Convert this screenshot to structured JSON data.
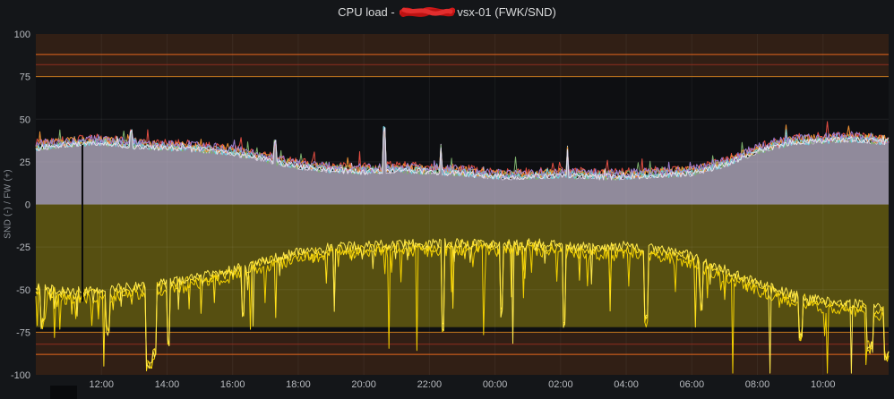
{
  "title": {
    "prefix": "CPU load - ",
    "suffix": "vsx-01 (FWK/SND)",
    "redacted_hint": "hostname scribbled out in red"
  },
  "chart_data": {
    "type": "line",
    "title": "CPU load - [redacted] vsx-01 (FWK/SND)",
    "ylabel": "SND (-) / FW (+)",
    "xlabel": "",
    "ylim": [
      -100,
      100
    ],
    "yticks": [
      100,
      75,
      50,
      25,
      0,
      -25,
      -50,
      -75,
      -100
    ],
    "ygrid": [
      75,
      50,
      25,
      0,
      -25,
      -50,
      -75
    ],
    "x_hours_span": 26,
    "xtick_hours": [
      2,
      4,
      6,
      8,
      10,
      12,
      14,
      16,
      18,
      20,
      22,
      24
    ],
    "xtick_labels": [
      "12:00",
      "14:00",
      "16:00",
      "18:00",
      "20:00",
      "22:00",
      "00:00",
      "02:00",
      "04:00",
      "06:00",
      "08:00",
      "10:00"
    ],
    "grid": true,
    "legend": "none",
    "samples": 640,
    "thresholds": {
      "bands": [
        {
          "from": 75,
          "to": 100,
          "color": "rgba(190,95,35,0.20)"
        },
        {
          "from": -100,
          "to": -75,
          "color": "rgba(190,95,35,0.20)"
        },
        {
          "from": -72,
          "to": 0,
          "color": "rgba(205,185,15,0.38)"
        }
      ],
      "lines": [
        {
          "v": 88,
          "color": "#e8671c"
        },
        {
          "v": 82,
          "color": "#8f2e1e"
        },
        {
          "v": 75,
          "color": "#c1761b"
        },
        {
          "v": -75,
          "color": "#c1761b"
        },
        {
          "v": -82,
          "color": "#8f2e1e"
        },
        {
          "v": -88,
          "color": "#e8671c"
        }
      ]
    },
    "envelopes": {
      "fw": [
        [
          0,
          33
        ],
        [
          1,
          35
        ],
        [
          2,
          36
        ],
        [
          3,
          34
        ],
        [
          4,
          33
        ],
        [
          5,
          32
        ],
        [
          6,
          30
        ],
        [
          7,
          26
        ],
        [
          8,
          22
        ],
        [
          9,
          20
        ],
        [
          10,
          19
        ],
        [
          11,
          20
        ],
        [
          12,
          19
        ],
        [
          13,
          18
        ],
        [
          14,
          16
        ],
        [
          15,
          16
        ],
        [
          16,
          17
        ],
        [
          17,
          16
        ],
        [
          18,
          16
        ],
        [
          19,
          17
        ],
        [
          20,
          18
        ],
        [
          21,
          23
        ],
        [
          22,
          31
        ],
        [
          23,
          36
        ],
        [
          24,
          37
        ],
        [
          25,
          38
        ],
        [
          26,
          36
        ]
      ],
      "snd": [
        [
          0,
          -50
        ],
        [
          1,
          -53
        ],
        [
          2,
          -52
        ],
        [
          3,
          -50
        ],
        [
          4,
          -48
        ],
        [
          5,
          -44
        ],
        [
          6,
          -40
        ],
        [
          7,
          -34
        ],
        [
          8,
          -30
        ],
        [
          9,
          -27
        ],
        [
          10,
          -26
        ],
        [
          11,
          -25
        ],
        [
          12,
          -25
        ],
        [
          13,
          -24
        ],
        [
          14,
          -25
        ],
        [
          15,
          -24
        ],
        [
          16,
          -26
        ],
        [
          17,
          -27
        ],
        [
          18,
          -26
        ],
        [
          19,
          -28
        ],
        [
          20,
          -32
        ],
        [
          21,
          -40
        ],
        [
          22,
          -48
        ],
        [
          23,
          -54
        ],
        [
          24,
          -58
        ],
        [
          25,
          -60
        ],
        [
          26,
          -63
        ]
      ]
    },
    "fw_area": {
      "seed": 100,
      "offset": 0,
      "amp": 1.6,
      "spike_p": 0.015,
      "spike_max": 5,
      "fill": "rgba(196,186,208,0.72)",
      "edge": "#cfc5da"
    },
    "fw_lines": [
      {
        "color": "#e24d42",
        "offset": 2.5,
        "amp": 3.0,
        "seed": 101,
        "spike_p": 0.025,
        "spike_max": 8
      },
      {
        "color": "#7eb26d",
        "offset": 1.0,
        "amp": 2.8,
        "seed": 102,
        "spike_p": 0.03,
        "spike_max": 9
      },
      {
        "color": "#ef9234",
        "offset": 1.8,
        "amp": 2.6,
        "seed": 103,
        "spike_p": 0.025,
        "spike_max": 7
      },
      {
        "color": "#6ed0e0",
        "offset": 0.6,
        "amp": 2.2,
        "seed": 104,
        "spike_p": 0.02,
        "spike_max": 6
      },
      {
        "color": "#9f7fd1",
        "offset": 2.2,
        "amp": 2.8,
        "seed": 105,
        "spike_p": 0.02,
        "spike_max": 7
      },
      {
        "color": "#e4e0ea",
        "offset": 0.2,
        "amp": 1.8,
        "seed": 106,
        "spike_p": 0.015,
        "spike_max": 5
      }
    ],
    "snd_lines": [
      {
        "color": "#ffdf1a",
        "offset": 0,
        "amp": 3.2,
        "seed": 201,
        "spike_p": 0.05,
        "spike_max": 20,
        "deep_p": 0.01,
        "deep_max": 40
      },
      {
        "color": "#f2d000",
        "offset": -2.5,
        "amp": 3.6,
        "seed": 202,
        "spike_p": 0.06,
        "spike_max": 24,
        "deep_p": 0.012,
        "deep_max": 38
      },
      {
        "color": "#ffe94d",
        "offset": 1.8,
        "amp": 2.8,
        "seed": 203,
        "spike_p": 0.05,
        "spike_max": 16,
        "deep_p": 0.008,
        "deep_max": 46
      }
    ],
    "snd_events": [
      {
        "h": 0.2,
        "w": 0.06,
        "depth": -70
      },
      {
        "h": 2.2,
        "w": 0.05,
        "depth": -73
      },
      {
        "h": 3.45,
        "w": 0.1,
        "depth": -94
      },
      {
        "h": 3.62,
        "w": 0.06,
        "depth": -87
      },
      {
        "h": 4.05,
        "w": 0.05,
        "depth": -79
      },
      {
        "h": 6.3,
        "w": 0.04,
        "depth": -66
      },
      {
        "h": 9.1,
        "w": 0.04,
        "depth": -60
      },
      {
        "h": 12.4,
        "w": 0.05,
        "depth": -72
      },
      {
        "h": 14.2,
        "w": 0.04,
        "depth": -64
      },
      {
        "h": 16.1,
        "w": 0.05,
        "depth": -70
      },
      {
        "h": 18.6,
        "w": 0.05,
        "depth": -68
      },
      {
        "h": 20.3,
        "w": 0.04,
        "depth": -62
      },
      {
        "h": 23.3,
        "w": 0.06,
        "depth": -76
      },
      {
        "h": 25.45,
        "w": 0.1,
        "depth": -84
      },
      {
        "h": 25.95,
        "w": 0.08,
        "depth": -89
      }
    ],
    "fw_events": [
      {
        "h": 2.9,
        "w": 0.03,
        "to": 43
      },
      {
        "h": 7.3,
        "w": 0.03,
        "to": 36
      },
      {
        "h": 10.63,
        "w": 0.04,
        "to": 44
      },
      {
        "h": 12.35,
        "w": 0.03,
        "to": 34
      },
      {
        "h": 16.2,
        "w": 0.03,
        "to": 33
      }
    ],
    "annotation": {
      "h": 1.42,
      "v_from": 35,
      "v_to": -57,
      "color": "#0b0b0d",
      "width": 2
    }
  }
}
